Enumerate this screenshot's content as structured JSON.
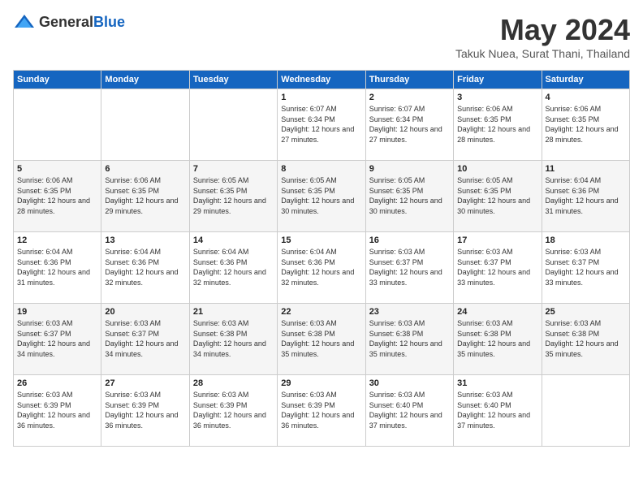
{
  "header": {
    "logo_general": "General",
    "logo_blue": "Blue",
    "month_year": "May 2024",
    "location": "Takuk Nuea, Surat Thani, Thailand"
  },
  "days_of_week": [
    "Sunday",
    "Monday",
    "Tuesday",
    "Wednesday",
    "Thursday",
    "Friday",
    "Saturday"
  ],
  "weeks": [
    [
      {
        "day": "",
        "sunrise": "",
        "sunset": "",
        "daylight": ""
      },
      {
        "day": "",
        "sunrise": "",
        "sunset": "",
        "daylight": ""
      },
      {
        "day": "",
        "sunrise": "",
        "sunset": "",
        "daylight": ""
      },
      {
        "day": "1",
        "sunrise": "Sunrise: 6:07 AM",
        "sunset": "Sunset: 6:34 PM",
        "daylight": "Daylight: 12 hours and 27 minutes."
      },
      {
        "day": "2",
        "sunrise": "Sunrise: 6:07 AM",
        "sunset": "Sunset: 6:34 PM",
        "daylight": "Daylight: 12 hours and 27 minutes."
      },
      {
        "day": "3",
        "sunrise": "Sunrise: 6:06 AM",
        "sunset": "Sunset: 6:35 PM",
        "daylight": "Daylight: 12 hours and 28 minutes."
      },
      {
        "day": "4",
        "sunrise": "Sunrise: 6:06 AM",
        "sunset": "Sunset: 6:35 PM",
        "daylight": "Daylight: 12 hours and 28 minutes."
      }
    ],
    [
      {
        "day": "5",
        "sunrise": "Sunrise: 6:06 AM",
        "sunset": "Sunset: 6:35 PM",
        "daylight": "Daylight: 12 hours and 28 minutes."
      },
      {
        "day": "6",
        "sunrise": "Sunrise: 6:06 AM",
        "sunset": "Sunset: 6:35 PM",
        "daylight": "Daylight: 12 hours and 29 minutes."
      },
      {
        "day": "7",
        "sunrise": "Sunrise: 6:05 AM",
        "sunset": "Sunset: 6:35 PM",
        "daylight": "Daylight: 12 hours and 29 minutes."
      },
      {
        "day": "8",
        "sunrise": "Sunrise: 6:05 AM",
        "sunset": "Sunset: 6:35 PM",
        "daylight": "Daylight: 12 hours and 30 minutes."
      },
      {
        "day": "9",
        "sunrise": "Sunrise: 6:05 AM",
        "sunset": "Sunset: 6:35 PM",
        "daylight": "Daylight: 12 hours and 30 minutes."
      },
      {
        "day": "10",
        "sunrise": "Sunrise: 6:05 AM",
        "sunset": "Sunset: 6:35 PM",
        "daylight": "Daylight: 12 hours and 30 minutes."
      },
      {
        "day": "11",
        "sunrise": "Sunrise: 6:04 AM",
        "sunset": "Sunset: 6:36 PM",
        "daylight": "Daylight: 12 hours and 31 minutes."
      }
    ],
    [
      {
        "day": "12",
        "sunrise": "Sunrise: 6:04 AM",
        "sunset": "Sunset: 6:36 PM",
        "daylight": "Daylight: 12 hours and 31 minutes."
      },
      {
        "day": "13",
        "sunrise": "Sunrise: 6:04 AM",
        "sunset": "Sunset: 6:36 PM",
        "daylight": "Daylight: 12 hours and 32 minutes."
      },
      {
        "day": "14",
        "sunrise": "Sunrise: 6:04 AM",
        "sunset": "Sunset: 6:36 PM",
        "daylight": "Daylight: 12 hours and 32 minutes."
      },
      {
        "day": "15",
        "sunrise": "Sunrise: 6:04 AM",
        "sunset": "Sunset: 6:36 PM",
        "daylight": "Daylight: 12 hours and 32 minutes."
      },
      {
        "day": "16",
        "sunrise": "Sunrise: 6:03 AM",
        "sunset": "Sunset: 6:37 PM",
        "daylight": "Daylight: 12 hours and 33 minutes."
      },
      {
        "day": "17",
        "sunrise": "Sunrise: 6:03 AM",
        "sunset": "Sunset: 6:37 PM",
        "daylight": "Daylight: 12 hours and 33 minutes."
      },
      {
        "day": "18",
        "sunrise": "Sunrise: 6:03 AM",
        "sunset": "Sunset: 6:37 PM",
        "daylight": "Daylight: 12 hours and 33 minutes."
      }
    ],
    [
      {
        "day": "19",
        "sunrise": "Sunrise: 6:03 AM",
        "sunset": "Sunset: 6:37 PM",
        "daylight": "Daylight: 12 hours and 34 minutes."
      },
      {
        "day": "20",
        "sunrise": "Sunrise: 6:03 AM",
        "sunset": "Sunset: 6:37 PM",
        "daylight": "Daylight: 12 hours and 34 minutes."
      },
      {
        "day": "21",
        "sunrise": "Sunrise: 6:03 AM",
        "sunset": "Sunset: 6:38 PM",
        "daylight": "Daylight: 12 hours and 34 minutes."
      },
      {
        "day": "22",
        "sunrise": "Sunrise: 6:03 AM",
        "sunset": "Sunset: 6:38 PM",
        "daylight": "Daylight: 12 hours and 35 minutes."
      },
      {
        "day": "23",
        "sunrise": "Sunrise: 6:03 AM",
        "sunset": "Sunset: 6:38 PM",
        "daylight": "Daylight: 12 hours and 35 minutes."
      },
      {
        "day": "24",
        "sunrise": "Sunrise: 6:03 AM",
        "sunset": "Sunset: 6:38 PM",
        "daylight": "Daylight: 12 hours and 35 minutes."
      },
      {
        "day": "25",
        "sunrise": "Sunrise: 6:03 AM",
        "sunset": "Sunset: 6:38 PM",
        "daylight": "Daylight: 12 hours and 35 minutes."
      }
    ],
    [
      {
        "day": "26",
        "sunrise": "Sunrise: 6:03 AM",
        "sunset": "Sunset: 6:39 PM",
        "daylight": "Daylight: 12 hours and 36 minutes."
      },
      {
        "day": "27",
        "sunrise": "Sunrise: 6:03 AM",
        "sunset": "Sunset: 6:39 PM",
        "daylight": "Daylight: 12 hours and 36 minutes."
      },
      {
        "day": "28",
        "sunrise": "Sunrise: 6:03 AM",
        "sunset": "Sunset: 6:39 PM",
        "daylight": "Daylight: 12 hours and 36 minutes."
      },
      {
        "day": "29",
        "sunrise": "Sunrise: 6:03 AM",
        "sunset": "Sunset: 6:39 PM",
        "daylight": "Daylight: 12 hours and 36 minutes."
      },
      {
        "day": "30",
        "sunrise": "Sunrise: 6:03 AM",
        "sunset": "Sunset: 6:40 PM",
        "daylight": "Daylight: 12 hours and 37 minutes."
      },
      {
        "day": "31",
        "sunrise": "Sunrise: 6:03 AM",
        "sunset": "Sunset: 6:40 PM",
        "daylight": "Daylight: 12 hours and 37 minutes."
      },
      {
        "day": "",
        "sunrise": "",
        "sunset": "",
        "daylight": ""
      }
    ]
  ]
}
